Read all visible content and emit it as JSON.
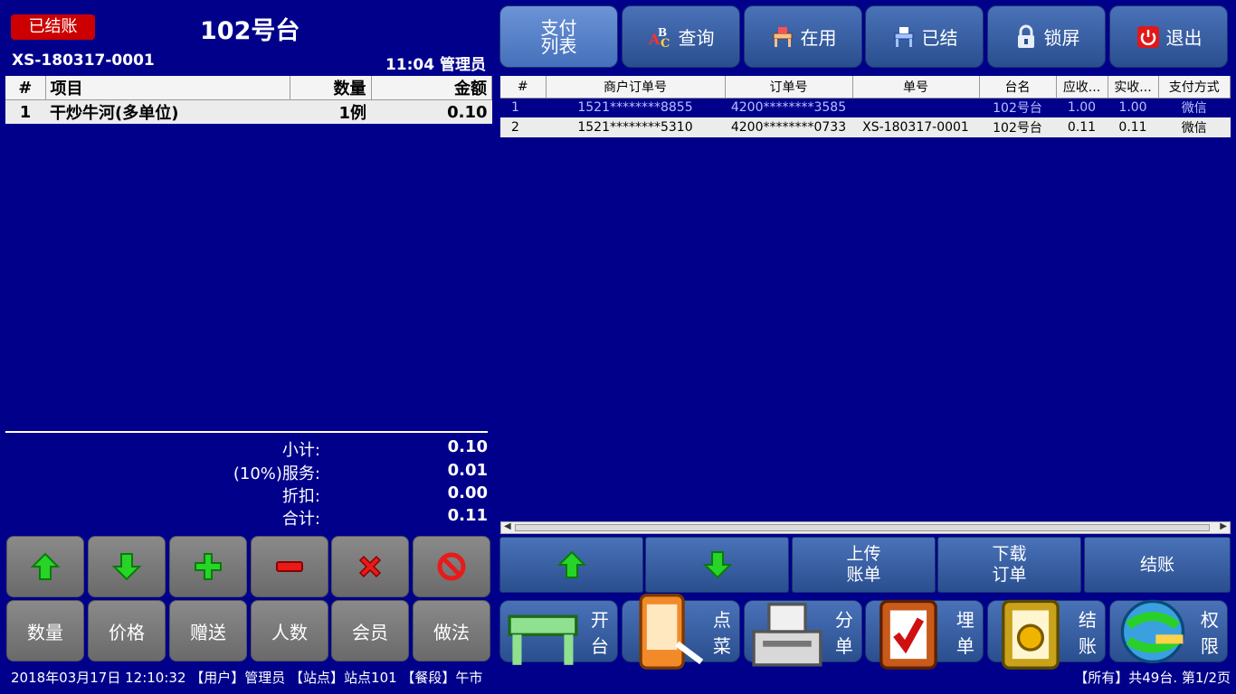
{
  "header": {
    "status_badge": "已结账",
    "table_name": "102号台",
    "order_no": "XS-180317-0001",
    "time_user": "11:04 管理员"
  },
  "order": {
    "columns": [
      "#",
      "项目",
      "数量",
      "金额"
    ],
    "rows": [
      {
        "no": "1",
        "item": "干炒牛河(多单位)",
        "qty": "1例",
        "amount": "0.10"
      }
    ]
  },
  "summary": {
    "subtotal_label": "小计:",
    "subtotal": "0.10",
    "service_label": "(10%)服务:",
    "service": "0.01",
    "discount_label": "折扣:",
    "discount": "0.00",
    "total_label": "合计:",
    "total": "0.11"
  },
  "left_buttons_row2": [
    "数量",
    "价格",
    "赠送",
    "人数",
    "会员",
    "做法"
  ],
  "toolbar": {
    "pay_list_line1": "支付",
    "pay_list_line2": "列表",
    "query": "查询",
    "in_use": "在用",
    "settled": "已结",
    "lock": "锁屏",
    "exit": "退出"
  },
  "payments": {
    "columns": [
      "#",
      "商户订单号",
      "订单号",
      "单号",
      "台名",
      "应收...",
      "实收...",
      "支付方式"
    ],
    "rows": [
      {
        "no": "1",
        "merchant_no": "1521********8855",
        "order_no": "4200********3585",
        "bill_no": "",
        "table": "102号台",
        "due": "1.00",
        "paid": "1.00",
        "method": "微信"
      },
      {
        "no": "2",
        "merchant_no": "1521********5310",
        "order_no": "4200********0733",
        "bill_no": "XS-180317-0001",
        "table": "102号台",
        "due": "0.11",
        "paid": "0.11",
        "method": "微信"
      }
    ]
  },
  "action_buttons": {
    "upload_line1": "上传",
    "upload_line2": "账单",
    "download_line1": "下载",
    "download_line2": "订单",
    "checkout": "结账"
  },
  "bottom_buttons": {
    "open_table": "开台",
    "order_food": "点菜",
    "split_bill": "分单",
    "bury_bill": "埋单",
    "checkout": "结账",
    "permissions": "权限"
  },
  "status_bar": {
    "left": "2018年03月17日  12:10:32 【用户】管理员 【站点】站点101 【餐段】午市",
    "right": "【所有】共49台. 第1/2页"
  },
  "colors": {
    "background": "#00008b",
    "badge": "#cc0000",
    "button_blue": "#3a62a8",
    "button_gray": "#7a7a7a"
  }
}
